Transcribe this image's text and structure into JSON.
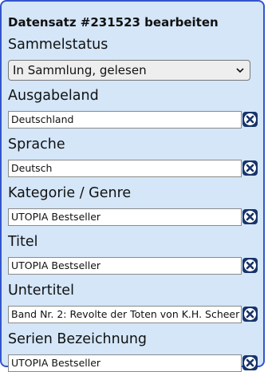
{
  "form": {
    "title": "Datensatz #231523 bearbeiten",
    "status": {
      "label": "Sammelstatus",
      "selected": "In Sammlung, gelesen"
    },
    "fields": [
      {
        "label": "Ausgabeland",
        "value": "Deutschland"
      },
      {
        "label": "Sprache",
        "value": "Deutsch"
      },
      {
        "label": "Kategorie / Genre",
        "value": "UTOPIA Bestseller"
      },
      {
        "label": "Titel",
        "value": "UTOPIA Bestseller"
      },
      {
        "label": "Untertitel",
        "value": "Band Nr. 2: Revolte der Toten von K.H. Scheer"
      },
      {
        "label": "Serien Bezeichnung",
        "value": "UTOPIA Bestseller"
      }
    ]
  },
  "icons": {
    "dropdown": "chevron-down-icon",
    "clear": "close-icon"
  },
  "colors": {
    "panel_background": "#d4e6f8",
    "panel_border": "#3355cc",
    "clear_button": "#17346b"
  }
}
